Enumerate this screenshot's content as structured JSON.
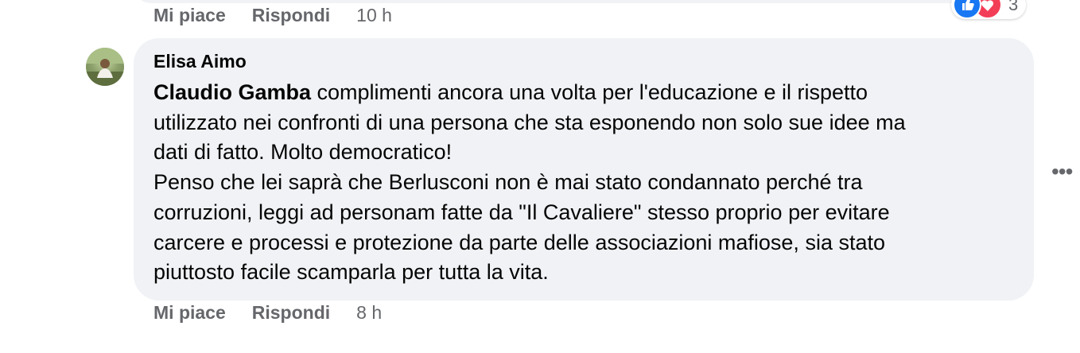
{
  "previous_comment": {
    "actions": {
      "like": "Mi piace",
      "reply": "Rispondi",
      "time": "10 h"
    },
    "reactions": {
      "icons": [
        "like-icon",
        "love-icon"
      ],
      "count": "3"
    }
  },
  "comment": {
    "author": "Elisa Aimo",
    "mention": "Claudio Gamba",
    "lines": [
      " complimenti ancora una volta per l'educazione e il rispetto",
      "utilizzato nei confronti di una persona che sta esponendo non solo sue idee ma",
      "dati di fatto. Molto democratico!",
      "Penso che lei saprà che Berlusconi non è mai stato condannato perché tra",
      "corruzioni, leggi ad personam fatte da \"Il Cavaliere\" stesso proprio per evitare",
      "carcere e processi e protezione da parte delle associazioni mafiose, sia stato",
      "piuttosto facile scamparla per tutta la vita."
    ],
    "actions": {
      "like": "Mi piace",
      "reply": "Rispondi",
      "time": "8 h"
    },
    "more_menu": "•••"
  },
  "colors": {
    "bubble": "#f0f2f5",
    "secondary_text": "#65676b",
    "like_blue": "#1877f2",
    "love_red": "#f33e58"
  }
}
